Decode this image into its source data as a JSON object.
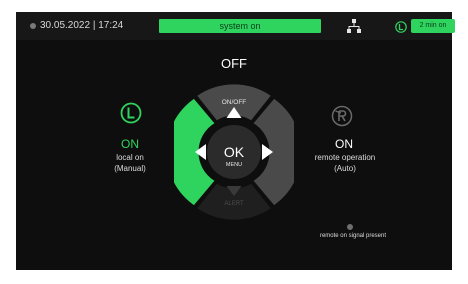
{
  "statusbar": {
    "datetime": "30.05.2022 | 17:24",
    "system_status": "system on",
    "timer": "2 min on",
    "network_icon": "network-icon",
    "local_icon": "local-mode-icon"
  },
  "main": {
    "state": "OFF"
  },
  "dpad": {
    "up_label": "ON/OFF",
    "center_label": "OK",
    "center_sub": "MENU",
    "down_label": "ALERT",
    "left_icon": "arrow-left-icon",
    "right_icon": "arrow-right-icon",
    "up_icon": "arrow-up-icon",
    "down_icon": "arrow-down-icon"
  },
  "local": {
    "status": "ON",
    "mode_line1": "local on",
    "mode_line2": "(Manual)",
    "icon": "local-mode-icon"
  },
  "remote": {
    "status": "ON",
    "mode_line1": "remote operation",
    "mode_line2": "(Auto)",
    "icon": "remote-mode-icon",
    "signal_text": "remote on signal present"
  },
  "colors": {
    "accent_green": "#2fd45f",
    "background": "#0e0e0e",
    "segment_dark": "#4a4a4a",
    "segment_darker": "#1f1f1f"
  }
}
